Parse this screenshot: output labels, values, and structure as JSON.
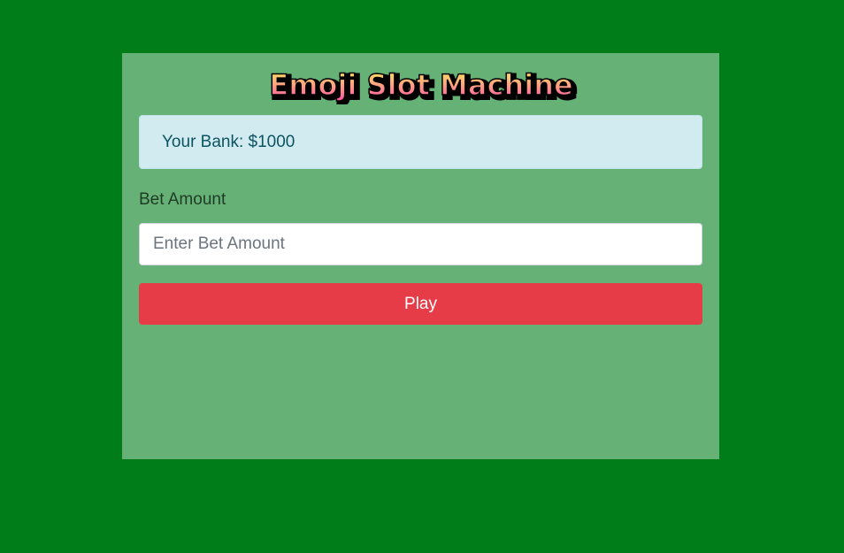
{
  "game": {
    "title": "Emoji Slot Machine",
    "bank_text": "Your Bank: $1000",
    "bet_label": "Bet Amount",
    "bet_placeholder": "Enter Bet Amount",
    "bet_value": "",
    "play_label": "Play"
  },
  "colors": {
    "background": "#007c19",
    "panel": "#66b276",
    "alert_bg": "#d1ebf1",
    "alert_text": "#0c5460",
    "play_button": "#e63c48",
    "title_gradient_top": "#fff35a",
    "title_gradient_bottom": "#ff4fa8"
  }
}
